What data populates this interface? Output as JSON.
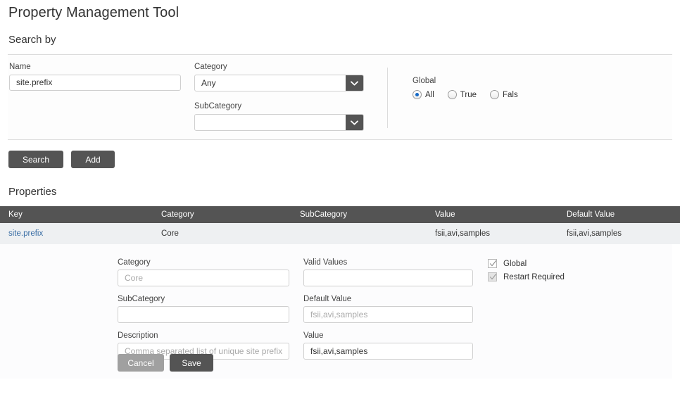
{
  "app": {
    "title": "Property Management Tool"
  },
  "search": {
    "heading": "Search by",
    "name": {
      "label": "Name",
      "value": "site.prefix"
    },
    "category": {
      "label": "Category",
      "value": "Any"
    },
    "subcategory": {
      "label": "SubCategory",
      "value": ""
    },
    "global": {
      "label": "Global",
      "options": [
        {
          "label": "All",
          "selected": true
        },
        {
          "label": "True",
          "selected": false
        },
        {
          "label": "Fals",
          "selected": false
        }
      ]
    },
    "buttons": {
      "search": "Search",
      "add": "Add"
    }
  },
  "properties": {
    "heading": "Properties",
    "columns": [
      "Key",
      "Category",
      "SubCategory",
      "Value",
      "Default Value"
    ],
    "rows": [
      {
        "key": "site.prefix",
        "category": "Core",
        "subcategory": "",
        "value": "fsii,avi,samples",
        "default_value": "fsii,avi,samples"
      }
    ]
  },
  "edit": {
    "category": {
      "label": "Category",
      "value": "",
      "placeholder": "Core"
    },
    "subcategory": {
      "label": "SubCategory",
      "value": "",
      "placeholder": ""
    },
    "description": {
      "label": "Description",
      "value": "",
      "placeholder": "Comma separated list of unique site prefixes req"
    },
    "valid_values": {
      "label": "Valid Values",
      "value": "",
      "placeholder": ""
    },
    "default_value": {
      "label": "Default Value",
      "value": "",
      "placeholder": "fsii,avi,samples"
    },
    "value": {
      "label": "Value",
      "value": "fsii,avi,samples",
      "placeholder": ""
    },
    "checkboxes": [
      {
        "label": "Global",
        "checked": true,
        "disabled": false
      },
      {
        "label": "Restart Required",
        "checked": true,
        "disabled": true
      }
    ],
    "buttons": {
      "cancel": "Cancel",
      "save": "Save"
    }
  },
  "colors": {
    "dark_chrome": "#545454",
    "link": "#3a6ea5",
    "radio_accent": "#1569c7",
    "table_row": "#eef0f2",
    "muted_button": "#a0a0a0"
  }
}
